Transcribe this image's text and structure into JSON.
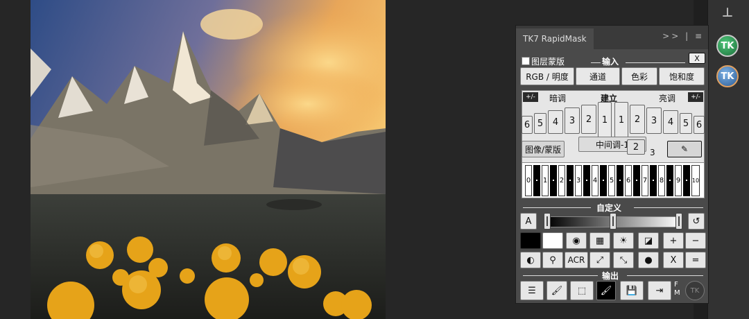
{
  "panel": {
    "tab_title": "TK7 RapidMask",
    "menu_glyph": ">> |  ≡"
  },
  "input": {
    "layer_mask_label": "图层蒙版",
    "section_title": "输入",
    "close_label": "X",
    "rgb_label": "RGB / 明度",
    "channel_label": "通道",
    "color_label": "色彩",
    "saturation_label": "饱和度"
  },
  "zones": {
    "plus_minus": "+/-",
    "dark_label": "暗调",
    "build_label": "建立",
    "light_label": "亮调",
    "dark_steps": [
      "6",
      "5",
      "4",
      "3",
      "2",
      "1"
    ],
    "light_steps": [
      "1",
      "2",
      "3",
      "4",
      "5",
      "6"
    ],
    "image_mask_label": "图像/蒙版",
    "midtone_label": "中间调-1",
    "mid_sub_2": "2",
    "mid_sub_3": "3"
  },
  "keys": {
    "white_keys": [
      "0",
      "1",
      "2",
      "3",
      "4",
      "5",
      "6",
      "7",
      "8",
      "9",
      "10"
    ]
  },
  "custom": {
    "section_title": "自定义",
    "a_label": "A",
    "acr_label": "ACR",
    "x_label": "X",
    "plus_label": "+",
    "minus_label": "−",
    "equals_label": "="
  },
  "output": {
    "section_title": "输出",
    "fm_label": "F\nM"
  },
  "dock": {
    "tk_label": "TK"
  }
}
